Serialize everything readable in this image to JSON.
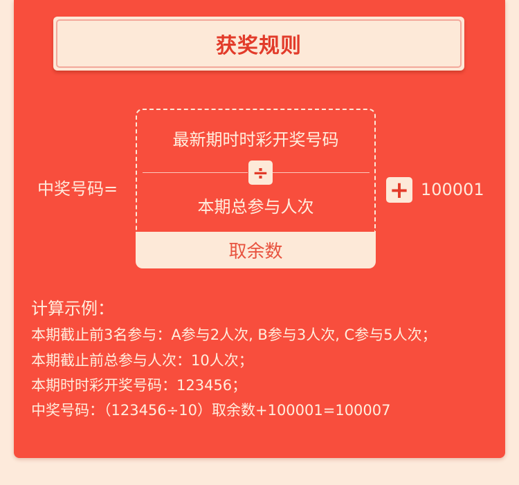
{
  "title": "获奖规则",
  "formula": {
    "left_label": "中奖号码=",
    "numerator": "最新期时时彩开奖号码",
    "divide_symbol": "÷",
    "denominator": "本期总参与人次",
    "mod_label": "取余数",
    "plus_symbol": "+",
    "plus_value": "100001"
  },
  "example": {
    "title": "计算示例：",
    "lines": [
      "本期截止前3名参与：A参与2人次, B参与3人次, C参与5人次；",
      "本期截止前总参与人次：10人次；",
      "本期时时彩开奖号码：123456；",
      "中奖号码：（123456÷10）取余数+100001=100007"
    ]
  },
  "colors": {
    "page_bg": "#fdeadb",
    "card_red": "#f84e3d",
    "cream": "#fde9d8",
    "accent_red": "#e23b2a"
  }
}
